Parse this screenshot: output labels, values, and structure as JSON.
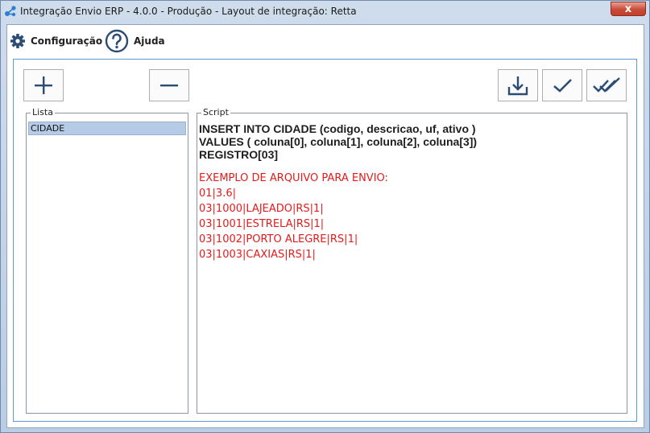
{
  "window": {
    "title": "Integração Envio ERP - 4.0.0 - Produção - Layout de integração: Retta",
    "close_glyph": "x"
  },
  "menu": {
    "config_label": "Configuração",
    "help_label": "Ajuda"
  },
  "toolbar": {
    "add": "add-icon",
    "remove": "minus-icon",
    "download": "download-icon",
    "check": "check-icon",
    "double_check": "double-check-icon"
  },
  "lista": {
    "legend": "Lista",
    "items": [
      "CIDADE"
    ]
  },
  "script": {
    "legend": "Script",
    "sql_lines": [
      "INSERT INTO CIDADE (codigo, descricao, uf, ativo )",
      "VALUES ( coluna[0], coluna[1], coluna[2], coluna[3])",
      "REGISTRO[03]"
    ],
    "example_lines": [
      "EXEMPLO DE ARQUIVO PARA ENVIO:",
      "01|3.6|",
      "03|1000|LAJEADO|RS|1|",
      "03|1001|ESTRELA|RS|1|",
      "03|1002|PORTO ALEGRE|RS|1|",
      "03|1003|CAXIAS|RS|1|"
    ]
  },
  "colors": {
    "example_text": "#e31b1b",
    "selection": "#b6cbe6",
    "icon_blue": "#2b5a8c"
  }
}
